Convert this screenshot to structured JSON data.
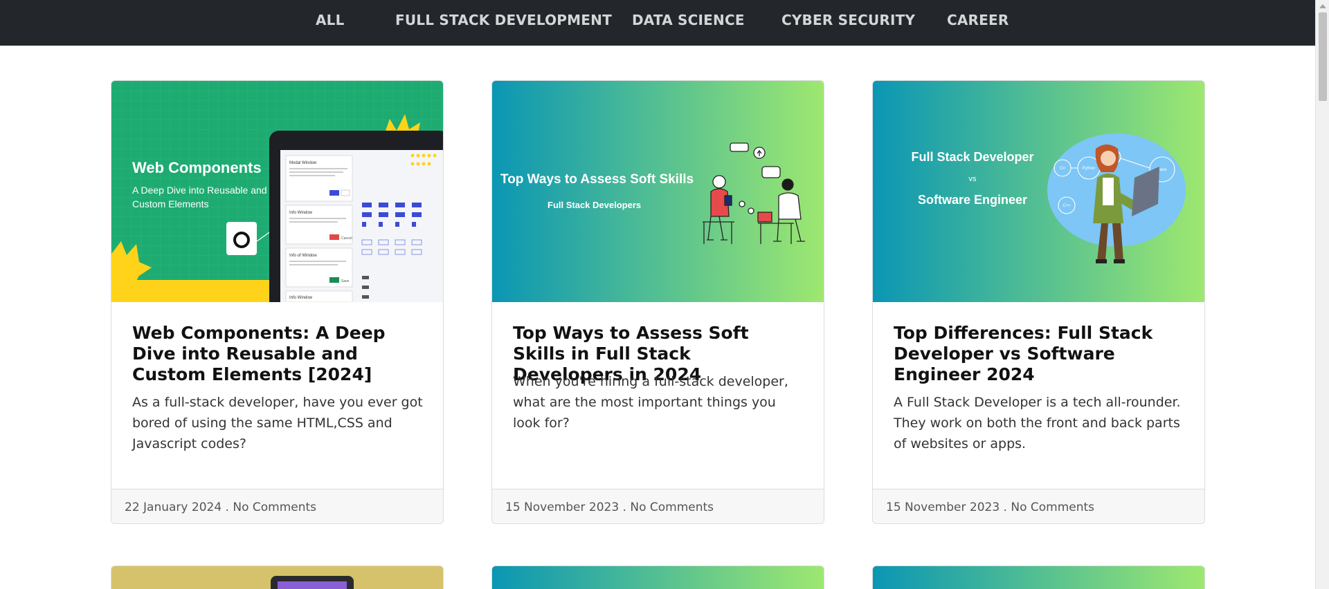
{
  "nav": {
    "items": [
      "ALL",
      "FULL STACK DEVELOPMENT",
      "DATA SCIENCE",
      "CYBER SECURITY",
      "CAREER"
    ]
  },
  "cards": [
    {
      "image": {
        "heading": "Web Components",
        "subheading_line1": "A Deep Dive into Reusable and",
        "subheading_line2": "Custom Elements",
        "panel_title": "Modal Window",
        "panel_items": [
          "Info Window",
          "Info of Window",
          "Info Window"
        ],
        "panel_buttons": [
          "Cancel",
          "Cancel",
          "Save"
        ]
      },
      "title": "Web Components: A Deep Dive into Reusable and Custom Elements [2024]",
      "excerpt": "As a full-stack developer, have you ever got bored of using the same HTML,CSS and Javascript codes?",
      "date": "22 January 2024",
      "comments": "No Comments"
    },
    {
      "image": {
        "heading": "Top Ways to Assess Soft Skills",
        "subheading": "Full Stack Developers"
      },
      "title": "Top Ways to Assess Soft Skills in Full Stack Developers in 2024",
      "excerpt": "When you're hiring a full-stack developer, what are the most important things you look for?",
      "date": "15 November 2023",
      "comments": "No Comments"
    },
    {
      "image": {
        "line1": "Full Stack Developer",
        "line2": "vs",
        "line3": "Software Engineer",
        "bubbles": [
          "Python",
          "C#",
          "JS",
          "Java",
          "C++"
        ]
      },
      "title": "Top Differences: Full Stack Developer vs Software Engineer 2024",
      "excerpt": "A Full Stack Developer is a tech all-rounder. They work on both the front and back parts of websites or apps.",
      "date": "15 November 2023",
      "comments": "No Comments"
    }
  ],
  "colors": {
    "nav_bg": "#23272b",
    "nav_text": "#d4d6d8",
    "gradient_start": "#0a96b4",
    "gradient_end": "#9ee870",
    "webcomp_green": "#1eab72",
    "webcomp_yellow": "#ffd31a"
  }
}
